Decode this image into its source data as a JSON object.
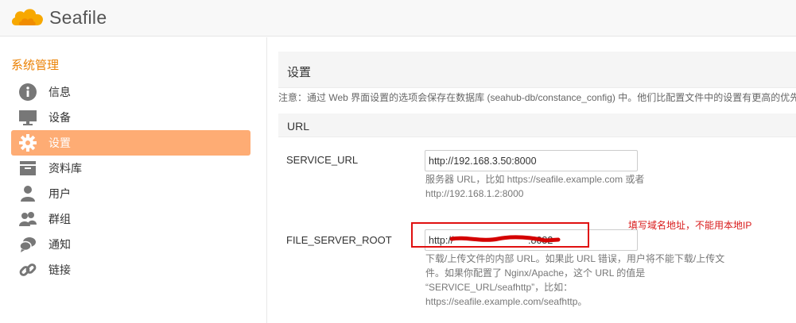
{
  "header": {
    "app_name": "Seafile"
  },
  "sidebar": {
    "title": "系统管理",
    "items": [
      {
        "label": "信息",
        "icon": "info-icon",
        "active": false
      },
      {
        "label": "设备",
        "icon": "monitor-icon",
        "active": false
      },
      {
        "label": "设置",
        "icon": "gear-icon",
        "active": true
      },
      {
        "label": "资料库",
        "icon": "archive-icon",
        "active": false
      },
      {
        "label": "用户",
        "icon": "user-icon",
        "active": false
      },
      {
        "label": "群组",
        "icon": "group-icon",
        "active": false
      },
      {
        "label": "通知",
        "icon": "chat-icon",
        "active": false
      },
      {
        "label": "链接",
        "icon": "link-icon",
        "active": false
      }
    ]
  },
  "main": {
    "title": "设置",
    "notice": "注意：通过 Web 界面设置的选项会保存在数据库 (seahub-db/constance_config) 中。他们比配置文件中的设置有更高的优先",
    "section": "URL",
    "fields": [
      {
        "label": "SERVICE_URL",
        "value": "http://192.168.3.50:8000",
        "help_line1": "服务器 URL，比如 https://seafile.example.com 或者",
        "help_line2": "http://192.168.1.2:8000"
      },
      {
        "label": "FILE_SERVER_ROOT",
        "value": "http://                           :8082",
        "help_line1": "下载/上传文件的内部 URL。如果此 URL 错误，用户将不能下载/上传文",
        "help_line2": "件。如果你配置了 Nginx/Apache，这个 URL 的值是",
        "help_line3": "“SERVICE_URL/seafhttp”，比如：https://seafile.example.com/seafhttp。"
      }
    ]
  },
  "annotation": {
    "text": "填写域名地址，不能用本地IP",
    "color": "#e01010"
  },
  "colors": {
    "accent": "#eb8205",
    "active_bg": "#feac74"
  }
}
